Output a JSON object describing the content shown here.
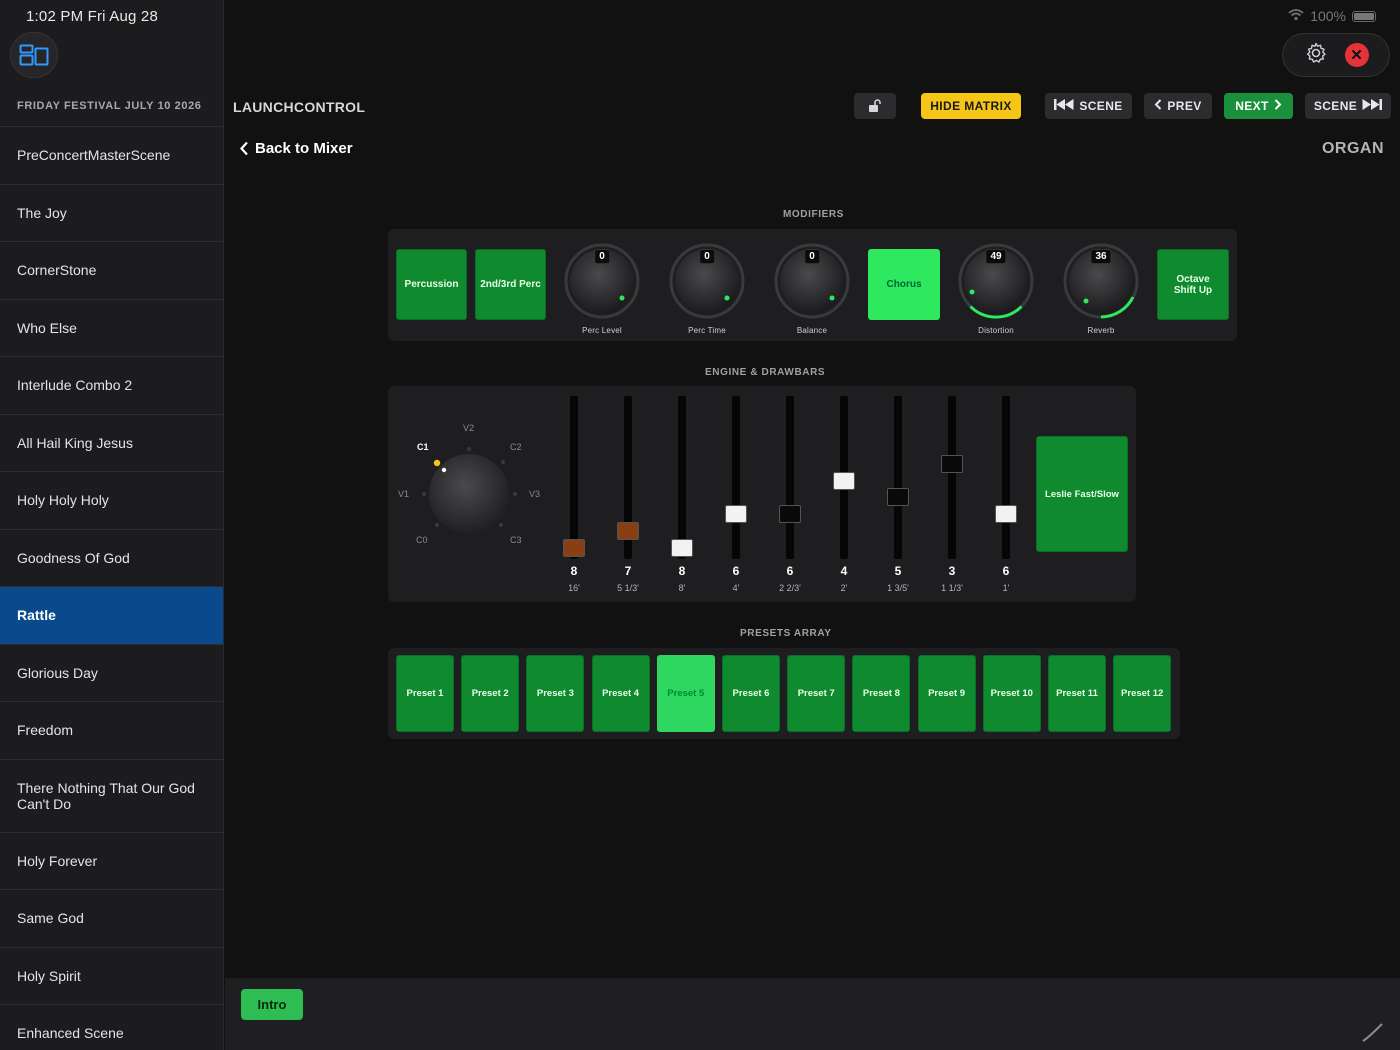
{
  "status": {
    "time": "1:02 PM  Fri Aug 28",
    "battery": "100%"
  },
  "sidebar": {
    "header": "FRIDAY FESTIVAL JULY 10 2026",
    "scenes": [
      "PreConcertMasterScene",
      "The Joy",
      "CornerStone",
      "Who Else",
      "Interlude Combo 2",
      "All Hail King Jesus",
      "Holy Holy Holy",
      "Goodness Of God",
      "Rattle",
      "Glorious Day",
      "Freedom",
      "There Nothing That Our God Can't Do",
      "Holy Forever",
      "Same God",
      "Holy Spirit",
      "Enhanced Scene"
    ],
    "active_scene": "Rattle"
  },
  "header": {
    "app_title": "LAUNCHCONTROL",
    "back_label": "Back to Mixer",
    "instrument": "ORGAN",
    "hide_matrix": "HIDE MATRIX",
    "scene_prev": "SCENE",
    "prev": "PREV",
    "next": "NEXT",
    "scene_next": "SCENE"
  },
  "modifiers": {
    "label": "MODIFIERS",
    "pads": {
      "percussion": "Percussion",
      "perc_2nd3rd": "2nd/3rd Perc",
      "chorus": "Chorus",
      "octave": "Octave Shift Up"
    },
    "knobs": [
      {
        "label": "Perc Level",
        "value": "0"
      },
      {
        "label": "Perc Time",
        "value": "0"
      },
      {
        "label": "Balance",
        "value": "0"
      },
      {
        "label": "Distortion",
        "value": "49"
      },
      {
        "label": "Reverb",
        "value": "36"
      }
    ],
    "accent": "#2ee860"
  },
  "engine": {
    "label": "ENGINE & DRAWBARS",
    "vibrato_labels": {
      "c1": "C1",
      "v2": "V2",
      "c2": "C2",
      "v1": "V1",
      "v3": "V3",
      "c0": "C0",
      "c3": "C3"
    },
    "vibrato_selected": "C1",
    "drawbars": [
      {
        "value": "8",
        "name": "16'",
        "level": 8,
        "color": "#8a3e14"
      },
      {
        "value": "7",
        "name": "5 1/3'",
        "level": 7,
        "color": "#8a3e14"
      },
      {
        "value": "8",
        "name": "8'",
        "level": 8,
        "color": "#f2f2f2"
      },
      {
        "value": "6",
        "name": "4'",
        "level": 6,
        "color": "#f2f2f2"
      },
      {
        "value": "6",
        "name": "2 2/3'",
        "level": 6,
        "color": "#0a0a0a"
      },
      {
        "value": "4",
        "name": "2'",
        "level": 4,
        "color": "#f2f2f2"
      },
      {
        "value": "5",
        "name": "1 3/5'",
        "level": 5,
        "color": "#0a0a0a"
      },
      {
        "value": "3",
        "name": "1 1/3'",
        "level": 3,
        "color": "#0a0a0a"
      },
      {
        "value": "6",
        "name": "1'",
        "level": 6,
        "color": "#f2f2f2"
      }
    ],
    "leslie": "Leslie Fast/Slow"
  },
  "presets": {
    "label": "PRESETS ARRAY",
    "items": [
      "Preset 1",
      "Preset 2",
      "Preset 3",
      "Preset 4",
      "Preset 5",
      "Preset 6",
      "Preset 7",
      "Preset 8",
      "Preset 9",
      "Preset 10",
      "Preset 11",
      "Preset 12"
    ],
    "active": "Preset 5"
  },
  "footer": {
    "intro": "Intro"
  }
}
